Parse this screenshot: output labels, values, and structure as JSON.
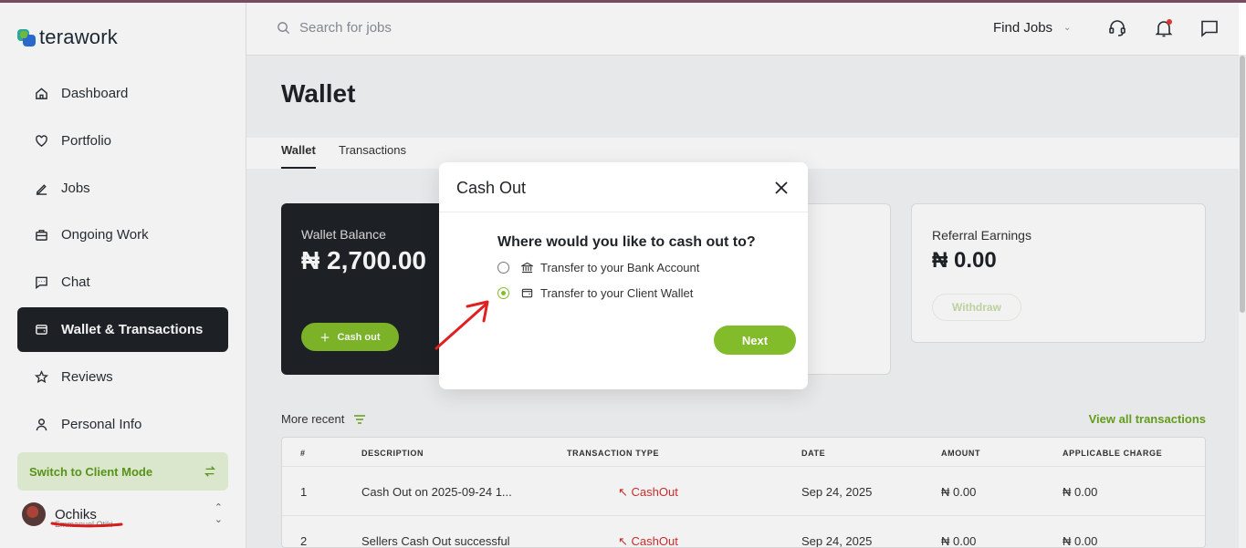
{
  "brand": {
    "name": "terawork"
  },
  "sidebar": {
    "items": [
      {
        "label": "Dashboard",
        "icon": "home-icon"
      },
      {
        "label": "Portfolio",
        "icon": "heart-icon"
      },
      {
        "label": "Jobs",
        "icon": "pen-icon"
      },
      {
        "label": "Ongoing Work",
        "icon": "briefcase-icon"
      },
      {
        "label": "Chat",
        "icon": "chat-icon"
      },
      {
        "label": "Wallet & Transactions",
        "icon": "wallet-icon",
        "active": true
      },
      {
        "label": "Reviews",
        "icon": "star-icon"
      },
      {
        "label": "Personal Info",
        "icon": "person-icon"
      }
    ],
    "switch_mode": "Switch to Client Mode",
    "user": {
      "name": "Ochiks",
      "sub": "Emmanuel Otiki"
    }
  },
  "header": {
    "search_placeholder": "Search for jobs",
    "find_jobs": "Find Jobs"
  },
  "main": {
    "title": "Wallet",
    "tabs": [
      "Wallet",
      "Transactions"
    ],
    "wallet_balance": {
      "label": "Wallet Balance",
      "amount": "₦ 2,700.00",
      "button": "Cash out"
    },
    "referral": {
      "label": "Referral Earnings",
      "amount": "₦ 0.00",
      "button": "Withdraw"
    },
    "recent_label": "More recent",
    "view_all": "View all transactions",
    "table": {
      "headers": [
        "#",
        "DESCRIPTION",
        "TRANSACTION TYPE",
        "DATE",
        "AMOUNT",
        "APPLICABLE CHARGE"
      ],
      "rows": [
        {
          "num": "1",
          "description": "Cash Out on 2025-09-24 1...",
          "type": "CashOut",
          "date": "Sep 24, 2025",
          "amount": "₦ 0.00",
          "charge": "₦ 0.00"
        },
        {
          "num": "2",
          "description": "Sellers Cash Out successful",
          "type": "CashOut",
          "date": "Sep 24, 2025",
          "amount": "₦ 0.00",
          "charge": "₦ 0.00"
        }
      ]
    }
  },
  "modal": {
    "title": "Cash Out",
    "question": "Where would you like to cash out to?",
    "options": [
      {
        "label": "Transfer to your Bank Account",
        "icon": "bank-icon",
        "selected": false
      },
      {
        "label": "Transfer to your Client Wallet",
        "icon": "wallet-icon",
        "selected": true
      }
    ],
    "next": "Next"
  },
  "colors": {
    "accent": "#82bc2a",
    "dark": "#1f2328",
    "danger": "#d32f2f"
  }
}
